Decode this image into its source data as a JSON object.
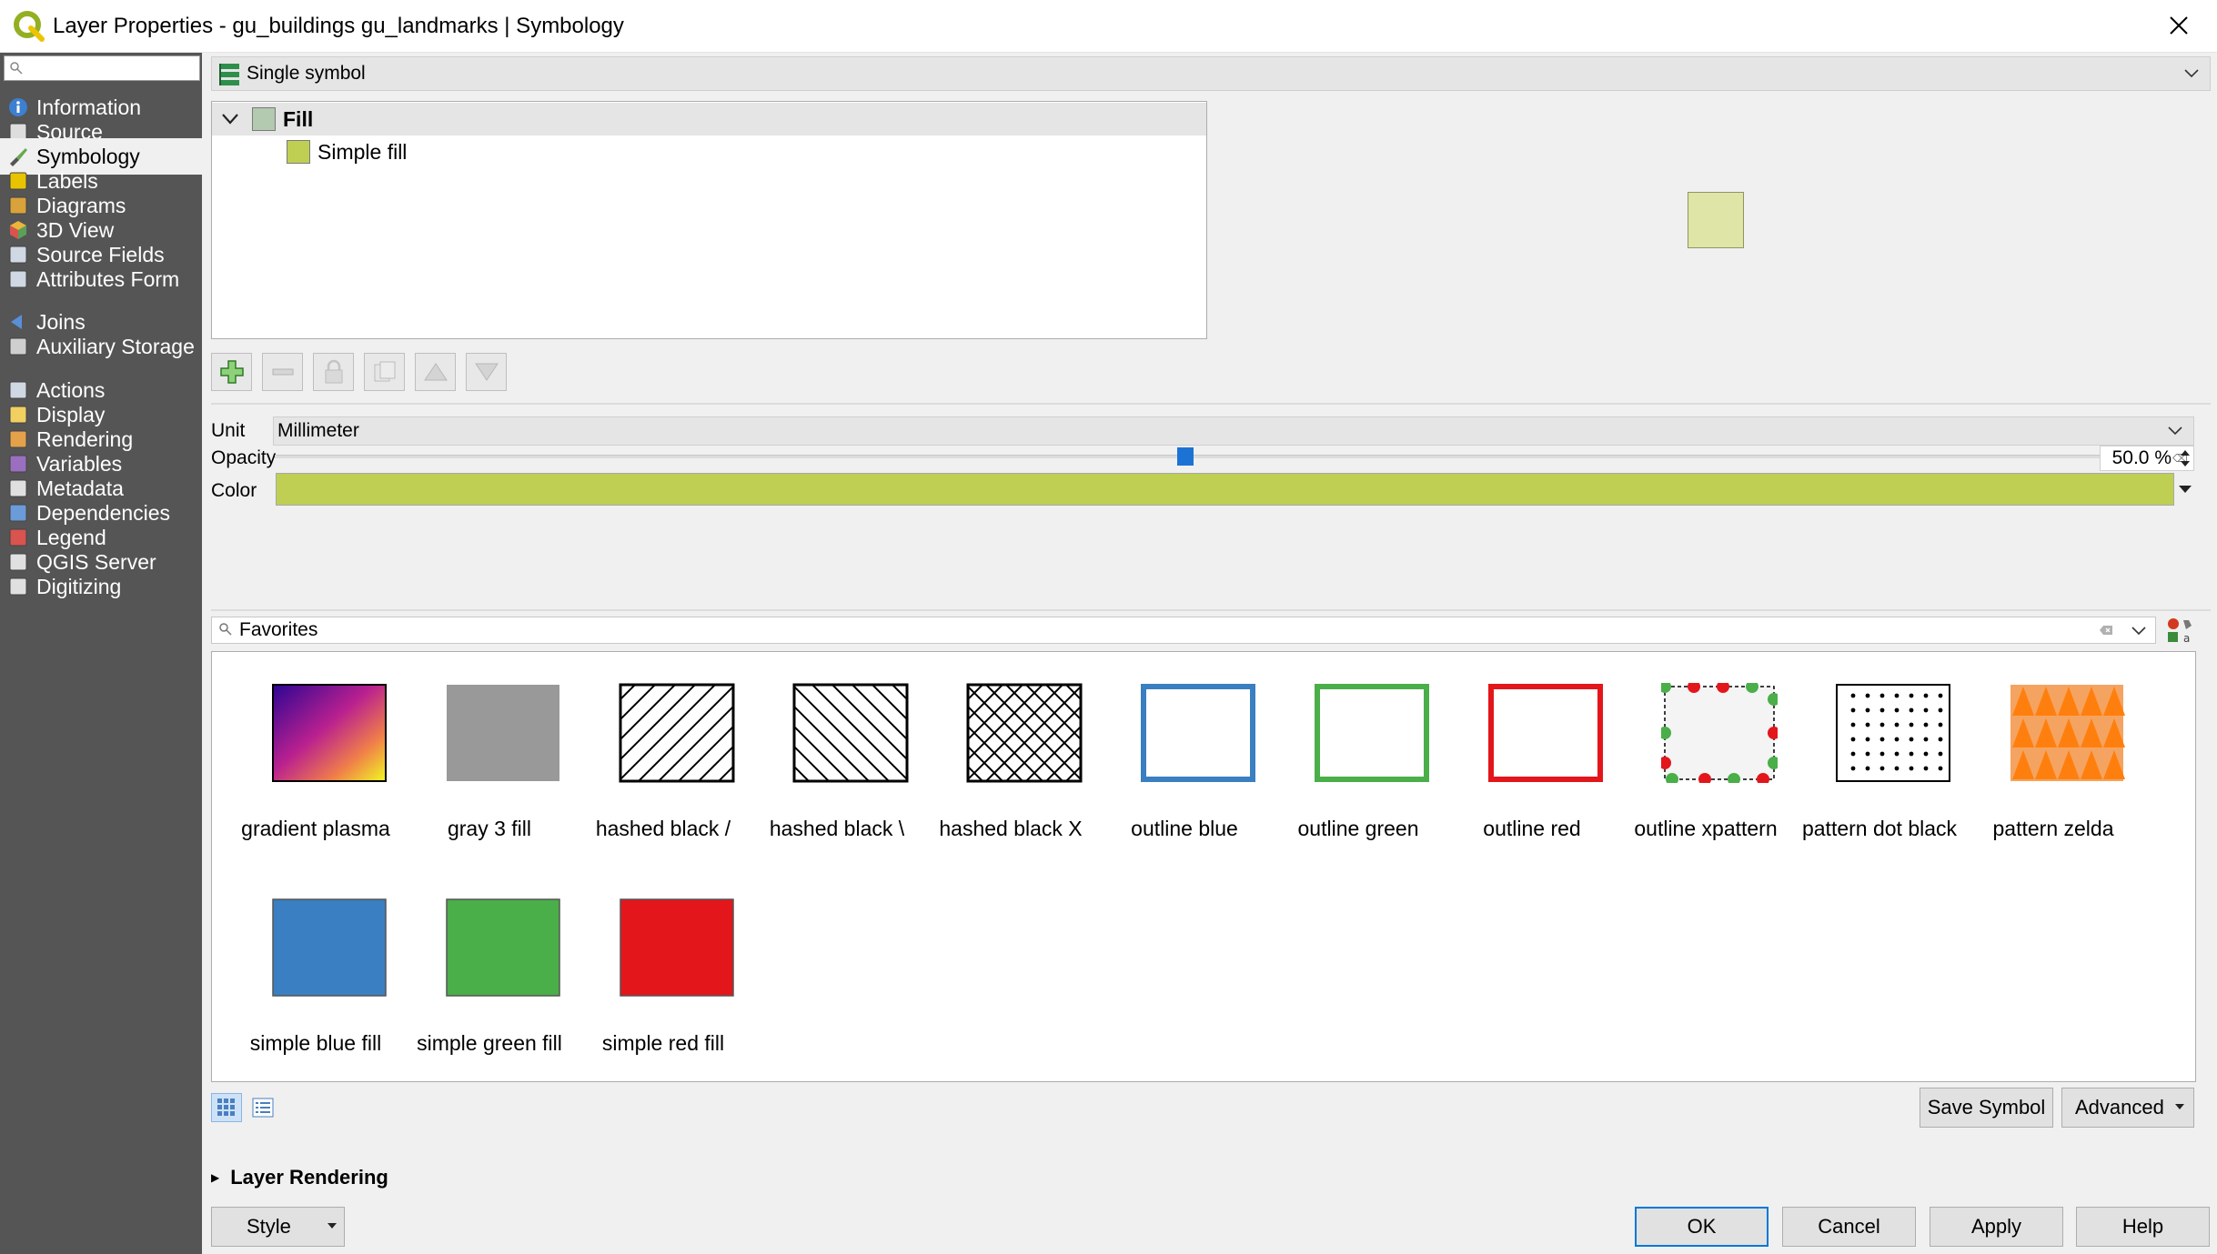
{
  "window": {
    "title": "Layer Properties - gu_buildings gu_landmarks | Symbology"
  },
  "sidebar": {
    "search_placeholder": "",
    "items": [
      {
        "label": "Information",
        "icon": "info-icon"
      },
      {
        "label": "Source",
        "icon": "source-icon"
      },
      {
        "label": "Symbology",
        "icon": "paintbrush-icon",
        "active": true
      },
      {
        "label": "Labels",
        "icon": "labels-icon"
      },
      {
        "label": "Diagrams",
        "icon": "diagrams-icon"
      },
      {
        "label": "3D View",
        "icon": "cube-icon"
      },
      {
        "label": "Source Fields",
        "icon": "fields-icon"
      },
      {
        "label": "Attributes Form",
        "icon": "form-icon"
      },
      {
        "label": "Joins",
        "icon": "joins-icon"
      },
      {
        "label": "Auxiliary Storage",
        "icon": "storage-icon"
      },
      {
        "label": "Actions",
        "icon": "actions-icon"
      },
      {
        "label": "Display",
        "icon": "display-icon"
      },
      {
        "label": "Rendering",
        "icon": "rendering-icon"
      },
      {
        "label": "Variables",
        "icon": "variables-icon"
      },
      {
        "label": "Metadata",
        "icon": "metadata-icon"
      },
      {
        "label": "Dependencies",
        "icon": "dependencies-icon"
      },
      {
        "label": "Legend",
        "icon": "legend-icon"
      },
      {
        "label": "QGIS Server",
        "icon": "server-icon"
      },
      {
        "label": "Digitizing",
        "icon": "digitizing-icon"
      }
    ]
  },
  "renderer": {
    "selected": "Single symbol"
  },
  "symbol_tree": {
    "root_label": "Fill",
    "child_label": "Simple fill",
    "root_color": "#b3c9b0",
    "child_color": "#bfcf53"
  },
  "properties": {
    "unit_label": "Unit",
    "unit_value": "Millimeter",
    "opacity_label": "Opacity",
    "opacity_value": "50.0 %",
    "opacity_fraction": 0.5,
    "color_label": "Color",
    "color_value": "#bfcf53"
  },
  "library": {
    "search_value": "Favorites",
    "symbols": [
      {
        "name": "gradient plasma",
        "kind": "gradient"
      },
      {
        "name": "gray 3 fill",
        "kind": "gray"
      },
      {
        "name": "hashed black /",
        "kind": "hash-fwd"
      },
      {
        "name": "hashed black \\",
        "kind": "hash-back"
      },
      {
        "name": "hashed black X",
        "kind": "hash-x"
      },
      {
        "name": "outline blue",
        "kind": "outline",
        "color": "#3a7fc1"
      },
      {
        "name": "outline green",
        "kind": "outline",
        "color": "#4aae49"
      },
      {
        "name": "outline red",
        "kind": "outline",
        "color": "#e3161b"
      },
      {
        "name": "outline xpattern",
        "kind": "xpattern"
      },
      {
        "name": "pattern dot black",
        "kind": "dots"
      },
      {
        "name": "pattern zelda",
        "kind": "zelda"
      },
      {
        "name": "simple blue fill",
        "kind": "solid",
        "color": "#3a7fc1"
      },
      {
        "name": "simple green fill",
        "kind": "solid",
        "color": "#4aae49"
      },
      {
        "name": "simple red fill",
        "kind": "solid",
        "color": "#e3161b"
      }
    ]
  },
  "buttons": {
    "save_symbol": "Save Symbol",
    "advanced": "Advanced",
    "layer_rendering": "Layer Rendering",
    "style": "Style",
    "ok": "OK",
    "cancel": "Cancel",
    "apply": "Apply",
    "help": "Help"
  }
}
